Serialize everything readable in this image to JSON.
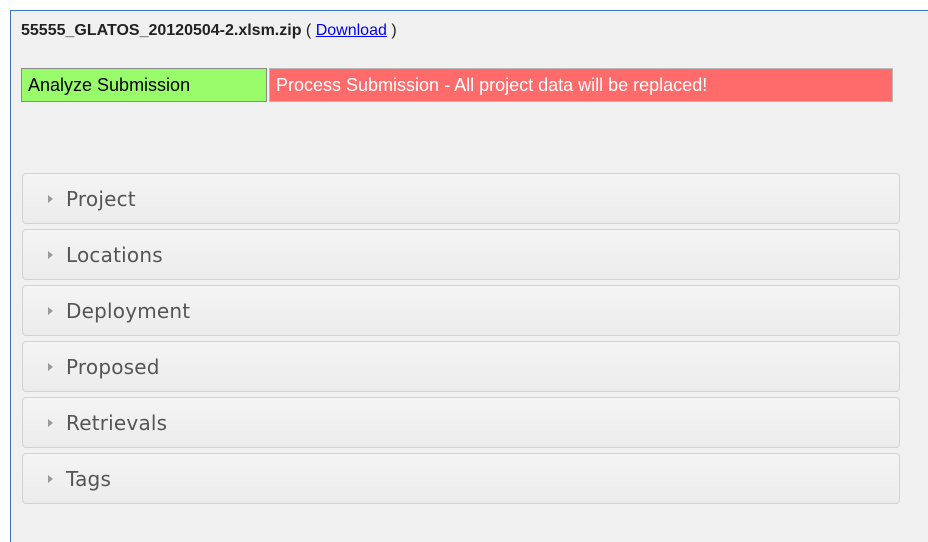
{
  "file": {
    "name": "55555_GLATOS_20120504-2.xlsm.zip",
    "paren_open": "(",
    "download_label": "Download",
    "paren_close": ")"
  },
  "actions": {
    "analyze_label": "Analyze Submission",
    "process_label": "Process Submission - All project data will be replaced!"
  },
  "sections": [
    {
      "label": "Project"
    },
    {
      "label": "Locations"
    },
    {
      "label": "Deployment"
    },
    {
      "label": "Proposed"
    },
    {
      "label": "Retrievals"
    },
    {
      "label": "Tags"
    }
  ],
  "colors": {
    "analyze_bg": "#98fb6a",
    "process_bg": "#ff6a6a",
    "panel_border": "#3c79b8"
  }
}
